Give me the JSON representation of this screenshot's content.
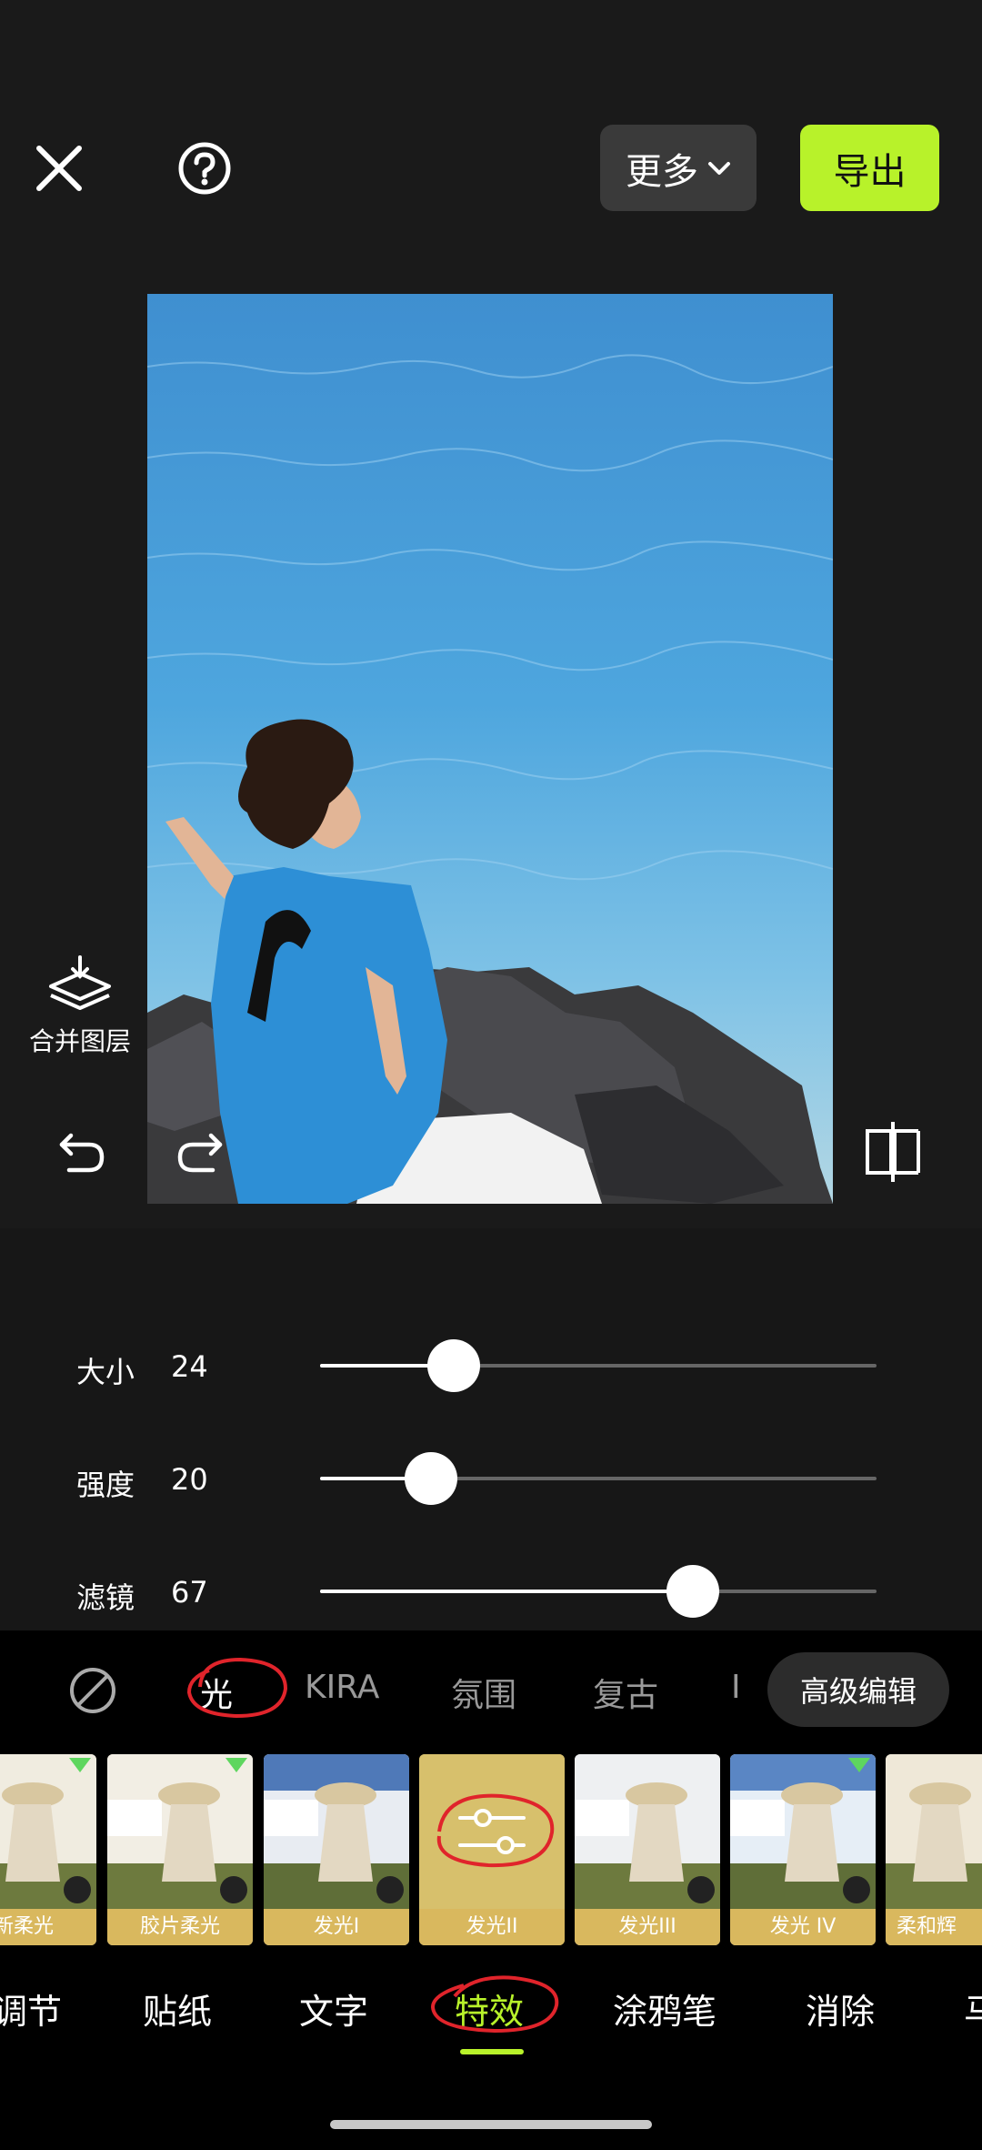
{
  "topbar": {
    "more_label": "更多",
    "export_label": "导出"
  },
  "side": {
    "merge_label": "合并图层"
  },
  "sliders": [
    {
      "label": "大小",
      "value": "24",
      "level": 24
    },
    {
      "label": "强度",
      "value": "20",
      "level": 20
    },
    {
      "label": "滤镜",
      "value": "67",
      "level": 67
    }
  ],
  "categories": [
    "光",
    "KIRA",
    "氛围",
    "复古",
    "I",
    "高级编辑"
  ],
  "thumbs": [
    "新柔光",
    "胶片柔光",
    "发光I",
    "发光II",
    "发光III",
    "发光 IV",
    "柔和辉"
  ],
  "tabs": [
    "调节",
    "贴纸",
    "文字",
    "特效",
    "涂鸦笔",
    "消除",
    "马"
  ],
  "colors": {
    "accent": "#b8f22a",
    "annotation": "#e0242b",
    "thumb_caption": "#d9b85e"
  }
}
